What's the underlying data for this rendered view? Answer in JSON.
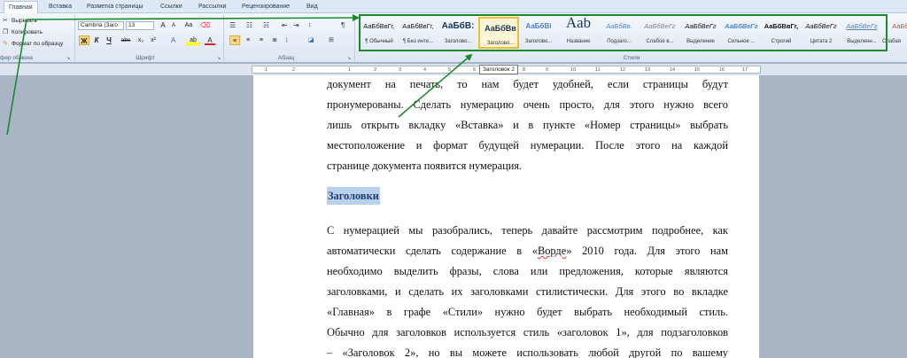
{
  "tabs": [
    "Главная",
    "Вставка",
    "Разметка страницы",
    "Ссылки",
    "Рассылки",
    "Рецензирование",
    "Вид"
  ],
  "clipboard": {
    "cut": "Вырезать",
    "copy": "Копировать",
    "format_painter": "Формат по образцу",
    "group_label": "фер обмена"
  },
  "font": {
    "name": "Cambria (Заго",
    "size": "13",
    "group_label": "Шрифт",
    "bold": "Ж",
    "italic": "К",
    "underline": "Ч",
    "strike": "abc",
    "subscript": "x₂",
    "superscript": "x²",
    "grow": "A",
    "shrink": "A",
    "clear": "Aa",
    "highlight": "ab",
    "color": "A"
  },
  "paragraph": {
    "group_label": "Абзац"
  },
  "styles": {
    "group_label": "Стили",
    "items": [
      {
        "sample": "АаБбВвГг,",
        "name": "¶ Обычный"
      },
      {
        "sample": "АаБбВвГг,",
        "name": "¶ Без инте..."
      },
      {
        "sample": "АаБбВ:",
        "name": "Заголово..."
      },
      {
        "sample": "АаБбВв",
        "name": "Заголово..."
      },
      {
        "sample": "АаБбВі",
        "name": "Заголово..."
      },
      {
        "sample": "Aab",
        "name": "Название"
      },
      {
        "sample": "АаБбВв.",
        "name": "Подзаго..."
      },
      {
        "sample": "АаБбВеГг",
        "name": "Слабое в..."
      },
      {
        "sample": "АаБбВеГг",
        "name": "Выделение"
      },
      {
        "sample": "АаБбВеГг",
        "name": "Сильное ..."
      },
      {
        "sample": "АаБбВвГг,",
        "name": "Строгий"
      },
      {
        "sample": "АаБбВеГг",
        "name": "Цитата 2"
      },
      {
        "sample": "АаБбВеГг",
        "name": "Выделенн..."
      },
      {
        "sample": "АаБбВ",
        "name": "Слабая"
      }
    ]
  },
  "tooltip": "Заголовок 2",
  "ruler": {
    "ticks": [
      "1",
      "2",
      "1",
      "2",
      "3",
      "4",
      "5",
      "6",
      "7",
      "8",
      "9",
      "10",
      "11",
      "12",
      "13",
      "14",
      "15",
      "16",
      "17"
    ]
  },
  "document": {
    "lines_top": [
      "документ на печать, то нам будет удобней, если страницы будут",
      "пронумерованы. Сделать нумерацию очень просто, для этого нужно всего",
      "лишь открыть вкладку «Вставка» и в пункте «Номер страницы» выбрать",
      "местоположение и формат будущей нумерации. После этого на каждой",
      "страниц­е документа появится нумерация."
    ],
    "heading": "Заголовки",
    "line_b1": "С нумерацией мы разобрались, теперь давайте рассмотрим подробнее, как",
    "line_b2_start": "автоматически сделать содержание в «",
    "line_b2_word": "Ворде",
    "line_b2_end": "» 2010 года. Для этого нам",
    "lines_bottom": [
      "необходимо выделить фразы, слова или предложения, которые являются",
      "заголовками, и сделать их заголовками стилистически. Для этого во вкладке",
      "«Главная» в графе «Стили» нужно будет выбрать необходимый стиль.",
      "Обычно для заголовков используется стиль «заголовок 1», для подзаголовков",
      "– «Заголовок 2», но вы можете использовать любой другой по вашему"
    ]
  },
  "colors": {
    "annotation": "#1a8a2a",
    "selected_style": "#f0bf31",
    "heading_highlight": "#b8d2ee",
    "heading_text": "#1f3f73"
  }
}
